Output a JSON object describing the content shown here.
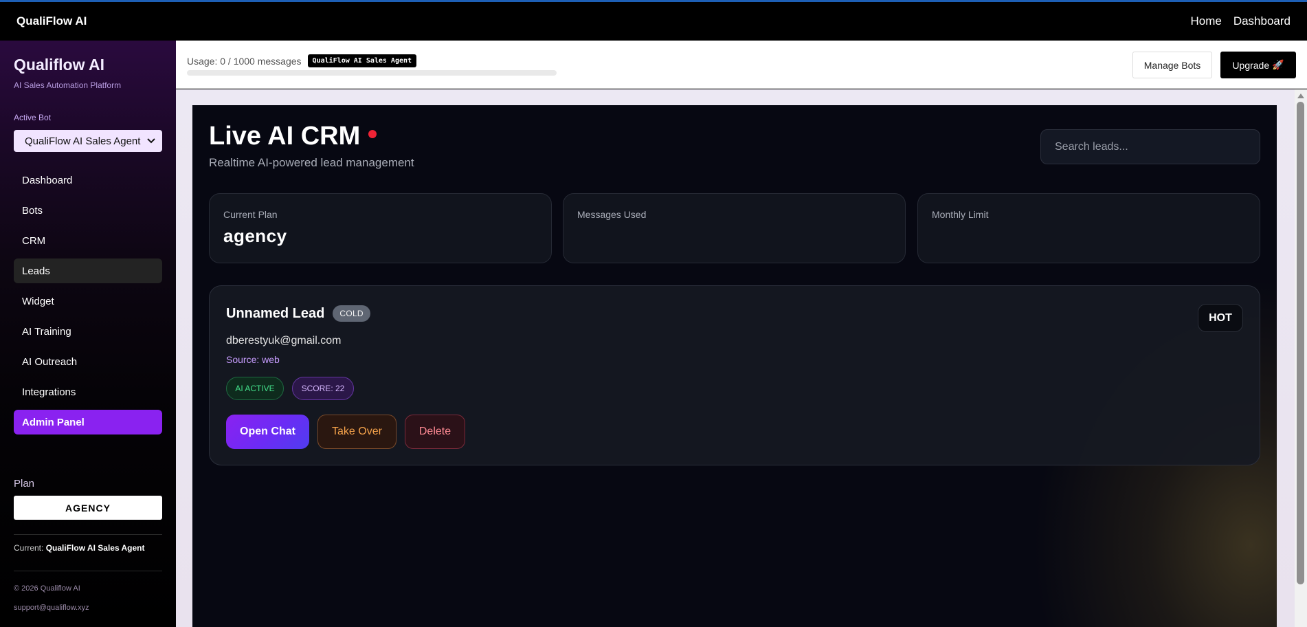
{
  "topnav": {
    "brand": "QualiFlow AI",
    "links": [
      "Home",
      "Dashboard"
    ]
  },
  "sidebar": {
    "title": "Qualiflow AI",
    "subtitle": "AI Sales Automation Platform",
    "active_bot_label": "Active Bot",
    "active_bot_value": "QualiFlow AI Sales Agent",
    "items": [
      {
        "label": "Dashboard"
      },
      {
        "label": "Bots"
      },
      {
        "label": "CRM"
      },
      {
        "label": "Leads"
      },
      {
        "label": "Widget"
      },
      {
        "label": "AI Training"
      },
      {
        "label": "AI Outreach"
      },
      {
        "label": "Integrations"
      },
      {
        "label": "Admin Panel"
      }
    ],
    "plan_label": "Plan",
    "plan_value": "AGENCY",
    "current_label": "Current:",
    "current_value": "QualiFlow AI Sales Agent",
    "copyright": "© 2026 Qualiflow AI",
    "support": "support@qualiflow.xyz"
  },
  "header": {
    "usage_text": "Usage: 0 / 1000 messages",
    "usage_fraction": 0,
    "bot_badge": "QualiFlow AI Sales Agent",
    "manage_bots": "Manage Bots",
    "upgrade": "Upgrade",
    "upgrade_icon": "🚀"
  },
  "crm": {
    "title": "Live AI CRM",
    "subtitle": "Realtime AI-powered lead management",
    "search_placeholder": "Search leads...",
    "stats": [
      {
        "label": "Current Plan",
        "value": "agency"
      },
      {
        "label": "Messages Used",
        "value": ""
      },
      {
        "label": "Monthly Limit",
        "value": ""
      }
    ],
    "live_dot_color": "#ef2335"
  },
  "lead": {
    "name": "Unnamed Lead",
    "status_badge": "COLD",
    "priority": "HOT",
    "email": "dberestyuk@gmail.com",
    "source": "Source: web",
    "tags": [
      "AI ACTIVE",
      "SCORE: 22"
    ],
    "actions": {
      "open_chat": "Open Chat",
      "take_over": "Take Over",
      "delete": "Delete"
    }
  },
  "colors": {
    "accent": "#8a22f0",
    "crm_bg": "#070812",
    "ai_active": "#43e08a",
    "take_over": "#f6a34b",
    "delete": "#ff8a93"
  }
}
